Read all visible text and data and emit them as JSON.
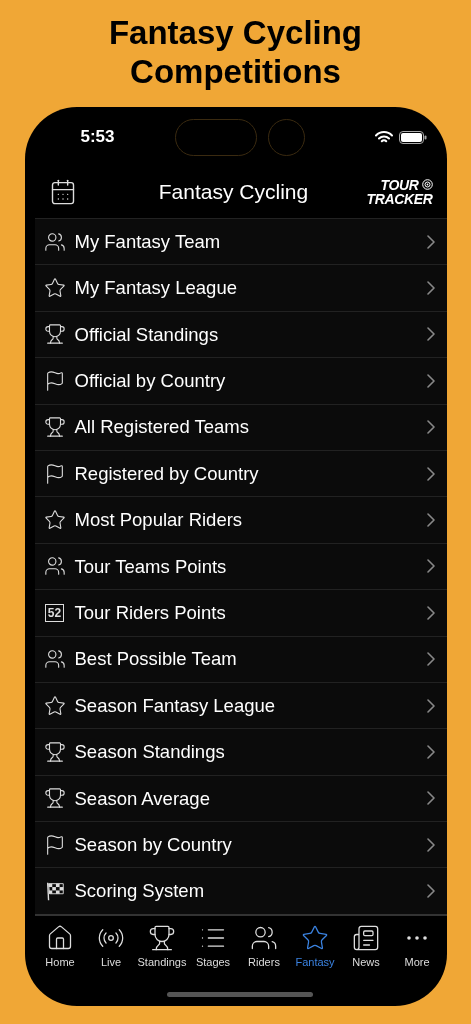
{
  "headline": [
    "Fantasy Cycling",
    "Competitions"
  ],
  "status_bar": {
    "time": "5:53"
  },
  "nav": {
    "title": "Fantasy Cycling",
    "logo": [
      "TOUR",
      "TRACKER"
    ]
  },
  "menu": [
    {
      "kind": "team",
      "label": "My Fantasy Team"
    },
    {
      "kind": "star",
      "label": "My Fantasy League"
    },
    {
      "kind": "trophy",
      "label": "Official Standings"
    },
    {
      "kind": "flag",
      "label": "Official by Country"
    },
    {
      "kind": "trophy",
      "label": "All Registered Teams"
    },
    {
      "kind": "flag",
      "label": "Registered by Country"
    },
    {
      "kind": "star",
      "label": "Most Popular Riders"
    },
    {
      "kind": "team",
      "label": "Tour Teams Points"
    },
    {
      "kind": "number",
      "icon_text": "52",
      "label": "Tour Riders Points"
    },
    {
      "kind": "team",
      "label": "Best Possible Team"
    },
    {
      "kind": "star",
      "label": "Season Fantasy League"
    },
    {
      "kind": "trophy",
      "label": "Season Standings"
    },
    {
      "kind": "trophy",
      "label": "Season Average"
    },
    {
      "kind": "flag",
      "label": "Season by Country"
    },
    {
      "kind": "checkered",
      "label": "Scoring System"
    }
  ],
  "tabs": [
    {
      "kind": "home",
      "label": "Home",
      "selected": false
    },
    {
      "kind": "live",
      "label": "Live",
      "selected": false
    },
    {
      "kind": "trophy",
      "label": "Standings",
      "selected": false
    },
    {
      "kind": "list",
      "label": "Stages",
      "selected": false
    },
    {
      "kind": "team",
      "label": "Riders",
      "selected": false
    },
    {
      "kind": "star",
      "label": "Fantasy",
      "selected": true
    },
    {
      "kind": "news",
      "label": "News",
      "selected": false
    },
    {
      "kind": "more",
      "label": "More",
      "selected": false
    }
  ]
}
